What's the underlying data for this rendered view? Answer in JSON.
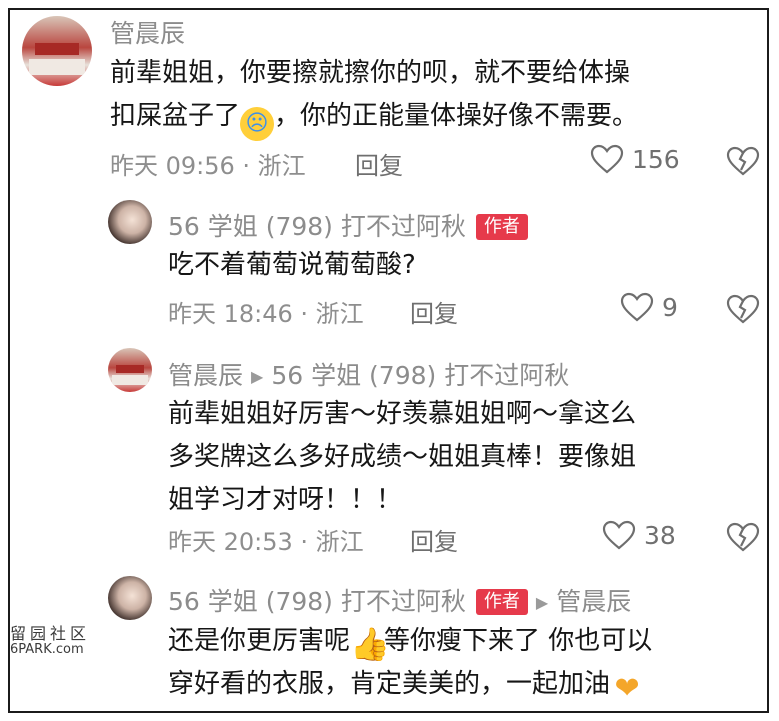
{
  "comments": [
    {
      "author": "管晨辰",
      "text_line1": "前辈姐姐，你要擦就擦你的呗，就不要给体操",
      "text_line2_a": "扣屎盆子了",
      "text_line2_emoji": "crying-face",
      "text_line2_b": "，你的正能量体操好像不需要。",
      "meta": "昨天 09:56 · 浙江",
      "reply": "回复",
      "likes": "156"
    },
    {
      "author": "56 学姐 (798) 打不过阿秋",
      "badge": "作者",
      "text_line1": "吃不着葡萄说葡萄酸?",
      "meta": "昨天 18:46 · 浙江",
      "reply": "回复",
      "likes": "9"
    },
    {
      "author": "管晨辰",
      "reply_to": "56 学姐 (798) 打不过阿秋",
      "text_line1": "前辈姐姐好厉害～好羡慕姐姐啊～拿这么",
      "text_line2": "多奖牌这么多好成绩～姐姐真棒！要像姐",
      "text_line3": "姐学习才对呀！！！",
      "meta": "昨天 20:53 · 浙江",
      "reply": "回复",
      "likes": "38"
    },
    {
      "author": "56 学姐 (798) 打不过阿秋",
      "badge": "作者",
      "reply_to": "管晨辰",
      "text_line1_a": "还是你更厉害呢",
      "text_line1_emoji": "thumbs-up",
      "text_line1_b": "等你瘦下来了 你也可以",
      "text_line2_a": "穿好看的衣服，肯定美美的，一起加油",
      "text_line2_emoji": "finger-heart"
    }
  ],
  "watermark": {
    "line1": "留园社区",
    "line2": "6PARK.com"
  },
  "colors": {
    "badge": "#e63a4b",
    "meta": "#8e8e8e",
    "text": "#161616"
  }
}
